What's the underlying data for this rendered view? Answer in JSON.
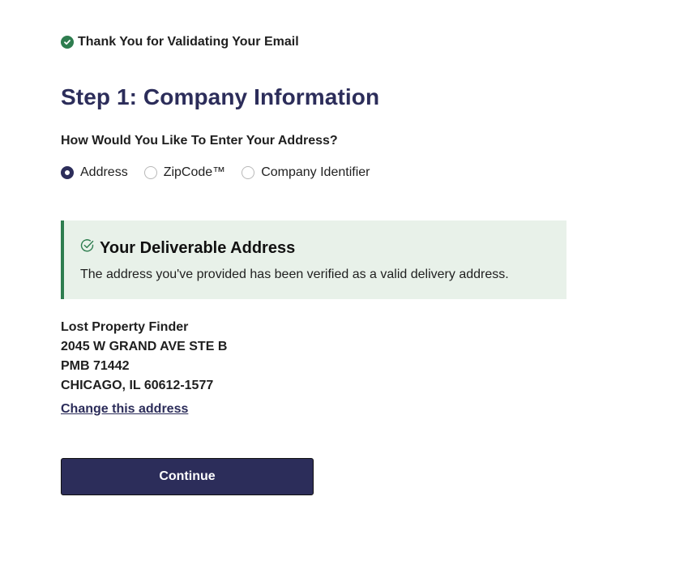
{
  "validation": {
    "message": "Thank You for Validating Your Email",
    "icon": "check-circle-icon",
    "color": "#2e7d4f"
  },
  "page": {
    "title": "Step 1: Company Information"
  },
  "address_entry": {
    "question": "How Would You Like To Enter Your Address?",
    "options": [
      {
        "label": "Address",
        "selected": true
      },
      {
        "label": "ZipCode™",
        "selected": false
      },
      {
        "label": "Company Identifier",
        "selected": false
      }
    ]
  },
  "deliverable_alert": {
    "heading": "Your Deliverable Address",
    "body": "The address you've provided has been verified as a valid delivery address.",
    "icon": "check-circle-outline-icon",
    "background": "#e8f1e9",
    "accent": "#2e7d4f"
  },
  "address": {
    "line1": "Lost Property Finder",
    "line2": "2045 W GRAND AVE STE B",
    "line3": "PMB 71442",
    "line4": "CHICAGO, IL 60612-1577"
  },
  "actions": {
    "change_link": "Change this address",
    "continue_label": "Continue",
    "primary_color": "#2c2d5a"
  }
}
